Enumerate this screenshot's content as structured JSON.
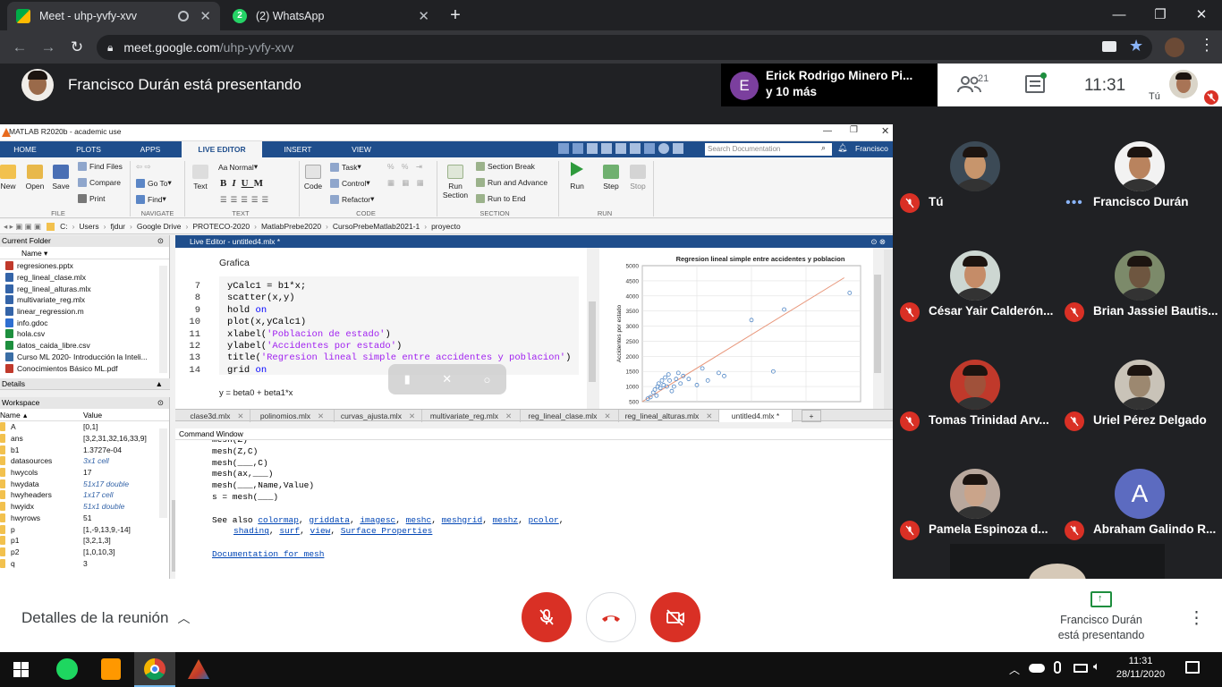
{
  "browser": {
    "tabs": [
      {
        "title": "Meet - uhp-yvfy-xvv",
        "active": true
      },
      {
        "title": "(2) WhatsApp",
        "active": false,
        "badge": "2"
      }
    ],
    "new_tab": "+",
    "url_host": "meet.google.com",
    "url_path": "/uhp-yvfy-xvv"
  },
  "meet": {
    "presenter_banner": "Francisco Durán está presentando",
    "top_speakers": "Erick Rodrigo Minero Pi...",
    "top_speakers_more": "y 10 más",
    "top_speakers_initial": "E",
    "participants_count": "21",
    "clock": "11:31",
    "self_label": "Tú",
    "participants": [
      {
        "name": "Tú",
        "muted": true
      },
      {
        "name": "Francisco Durán",
        "muted": false,
        "speaking": true
      },
      {
        "name": "César Yair Calderón...",
        "muted": true
      },
      {
        "name": "Brian Jassiel Bautis...",
        "muted": true
      },
      {
        "name": "Tomas Trinidad Arv...",
        "muted": true
      },
      {
        "name": "Uriel Pérez Delgado",
        "muted": true
      },
      {
        "name": "Pamela Espinoza d...",
        "muted": true
      },
      {
        "name": "Abraham Galindo R...",
        "muted": true,
        "initial": "A"
      }
    ],
    "meeting_details": "Detalles de la reunión",
    "presenting_line1": "Francisco Durán",
    "presenting_line2": "está presentando",
    "colors": {
      "red": "#d93025",
      "purple": "#7b3f9e",
      "blue": "#5c6bc0",
      "accent": "#1a73e8"
    }
  },
  "matlab": {
    "title": "MATLAB R2020b - academic use",
    "ribbon_tabs": [
      "HOME",
      "PLOTS",
      "APPS",
      "LIVE EDITOR",
      "INSERT",
      "VIEW"
    ],
    "search_placeholder": "Search Documentation",
    "user": "Francisco",
    "groups": {
      "file": "FILE",
      "navigate": "NAVIGATE",
      "text": "TEXT",
      "code": "CODE",
      "section": "SECTION",
      "run": "RUN"
    },
    "buttons": {
      "new": "New",
      "open": "Open",
      "save": "Save",
      "find_files": "Find Files",
      "compare": "Compare",
      "print": "Print",
      "go_to": "Go To",
      "find": "Find",
      "normal": "Normal",
      "text": "Text",
      "code": "Code",
      "task": "Task",
      "control": "Control",
      "refactor": "Refactor",
      "run_section": "Run Section",
      "section_break": "Section Break",
      "run_and_advance": "Run and Advance",
      "run_to_end": "Run to End",
      "run": "Run",
      "step": "Step",
      "stop": "Stop"
    },
    "path": [
      "Users",
      "fjdur",
      "Google Drive",
      "PROTECO-2020",
      "MatlabPrebe2020",
      "CursoPrebeMatlab2021-1",
      "proyecto"
    ],
    "path_drive": "C:",
    "current_folder": "Current Folder",
    "col_name": "Name",
    "files": [
      "regresiones.pptx",
      "reg_lineal_clase.mlx",
      "reg_lineal_alturas.mlx",
      "multivariate_reg.mlx",
      "linear_regression.m",
      "info.gdoc",
      "hola.csv",
      "datos_caida_libre.csv",
      "Curso ML 2020- Introducción la Inteli...",
      "Conocimientos Básico ML.pdf"
    ],
    "details": "Details",
    "workspace": "Workspace",
    "ws_cols": [
      "Name",
      "Value"
    ],
    "workspace_vars": [
      {
        "name": "A",
        "value": "[0,1]"
      },
      {
        "name": "ans",
        "value": "[3,2,31,32,16,33,9]"
      },
      {
        "name": "b1",
        "value": "1.3727e-04"
      },
      {
        "name": "datasources",
        "value": "3x1 cell",
        "italic": true
      },
      {
        "name": "hwycols",
        "value": "17"
      },
      {
        "name": "hwydata",
        "value": "51x17 double",
        "italic": true
      },
      {
        "name": "hwyheaders",
        "value": "1x17 cell",
        "italic": true
      },
      {
        "name": "hwyidx",
        "value": "51x1 double",
        "italic": true
      },
      {
        "name": "hwyrows",
        "value": "51"
      },
      {
        "name": "p",
        "value": "[1,-9,13,9,-14]"
      },
      {
        "name": "p1",
        "value": "[3,2,1,3]"
      },
      {
        "name": "p2",
        "value": "[1,0,10,3]"
      },
      {
        "name": "q",
        "value": "3"
      }
    ],
    "editor_title": "Live Editor - untitled4.mlx *",
    "section_heading": "Grafica",
    "line_numbers": [
      "7",
      "8",
      "9",
      "10",
      "11",
      "12",
      "13",
      "14"
    ],
    "code_lines": [
      {
        "pre": "yCalc1 = b1*x;"
      },
      {
        "pre": "scatter(x,y)"
      },
      {
        "pre": "hold ",
        "kw": "on"
      },
      {
        "pre": "plot(x,yCalc1)"
      },
      {
        "pre": "xlabel(",
        "str": "'Poblacion de estado'",
        "post": ")"
      },
      {
        "pre": "ylabel(",
        "str": "'Accidentes por estado'",
        "post": ")"
      },
      {
        "pre": "title(",
        "str": "'Regresion lineal simple entre accidentes y poblacion'",
        "post": ")"
      },
      {
        "pre": "grid ",
        "kw": "on"
      }
    ],
    "equation": "y = beta0 + beta1*x",
    "editor_tabs": [
      "clase3d.mlx",
      "polinomios.mlx",
      "curvas_ajusta.mlx",
      "multivariate_reg.mlx",
      "reg_lineal_clase.mlx",
      "reg_lineal_alturas.mlx",
      "untitled4.mlx *"
    ],
    "add_tab": "+",
    "command_window": "Command Window",
    "cmd_lines": [
      "mesh(Z)",
      "mesh(Z,C)",
      "mesh(___,C)",
      "mesh(ax,___)",
      "mesh(___,Name,Value)",
      "s = mesh(___)"
    ],
    "see_also": "See also",
    "see_also_links": [
      "colormap",
      "griddata",
      "imagesc",
      "meshc",
      "meshgrid",
      "meshz",
      "pcolor",
      "shading",
      "surf",
      "view",
      "Surface Properties"
    ],
    "doc_link": "Documentation for mesh"
  },
  "chart_data": {
    "type": "scatter",
    "title": "Regresion lineal simple entre accidentes y poblacion",
    "ylabel": "Accidentes por estado",
    "xlabel": "",
    "yticks": [
      500,
      1000,
      1500,
      2000,
      2500,
      3000,
      3500,
      4000,
      4500,
      5000
    ],
    "ylim": [
      500,
      5000
    ],
    "xlim": [
      0,
      40
    ],
    "grid": true,
    "points": [
      [
        1,
        600
      ],
      [
        1.5,
        650
      ],
      [
        2,
        800
      ],
      [
        2.3,
        900
      ],
      [
        2.6,
        700
      ],
      [
        2.8,
        1000
      ],
      [
        3,
        1100
      ],
      [
        3.3,
        950
      ],
      [
        3.6,
        1200
      ],
      [
        3.9,
        1050
      ],
      [
        4.2,
        1300
      ],
      [
        4.5,
        1000
      ],
      [
        4.8,
        1400
      ],
      [
        5,
        1200
      ],
      [
        5.4,
        850
      ],
      [
        5.8,
        1000
      ],
      [
        6.2,
        1250
      ],
      [
        6.6,
        1450
      ],
      [
        7,
        1100
      ],
      [
        7.5,
        1350
      ],
      [
        8.5,
        1250
      ],
      [
        10,
        1050
      ],
      [
        11,
        1600
      ],
      [
        12,
        1200
      ],
      [
        14,
        1450
      ],
      [
        15,
        1350
      ],
      [
        20,
        3200
      ],
      [
        24,
        1500
      ],
      [
        26,
        3550
      ],
      [
        38,
        4100
      ]
    ],
    "fit": [
      [
        0,
        0
      ],
      [
        37,
        4600
      ]
    ],
    "series": [
      {
        "name": "",
        "color": "#4f86c6"
      },
      {
        "name": "",
        "color": "#e8967a"
      }
    ]
  },
  "taskbar": {
    "time": "11:31",
    "date": "28/11/2020"
  }
}
